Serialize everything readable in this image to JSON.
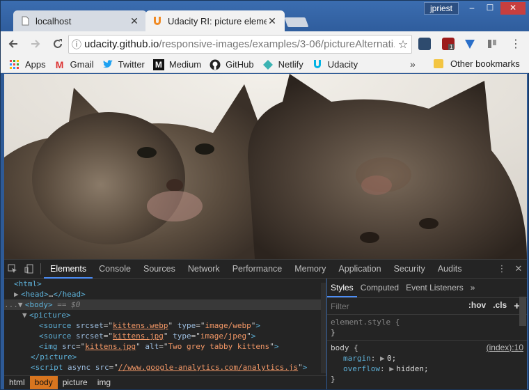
{
  "tabs": [
    {
      "title": "localhost",
      "active": false
    },
    {
      "title": "Udacity RI: picture eleme",
      "active": true
    }
  ],
  "user": "jpriest",
  "window_controls": {
    "minimize": "–",
    "maximize": "☐",
    "close": "✕"
  },
  "toolbar": {
    "url_host": "udacity.github.io",
    "url_path": "/responsive-images/examples/3-06/pictureAlternati..."
  },
  "extensions": [
    {
      "name": "udacity-ext",
      "color": "#2e4b6e"
    },
    {
      "name": "ublock-origin",
      "color": "#9c1b1b",
      "badge": "1"
    },
    {
      "name": "vpn-shield",
      "color": "#2a6fc9"
    },
    {
      "name": "readlater",
      "color": "#777777"
    }
  ],
  "bookmarks": {
    "items": [
      "Apps",
      "Gmail",
      "Twitter",
      "Medium",
      "GitHub",
      "Netlify",
      "Udacity"
    ],
    "more": "»",
    "other": "Other bookmarks"
  },
  "devtools": {
    "tabs": [
      "Elements",
      "Console",
      "Sources",
      "Network",
      "Performance",
      "Memory",
      "Application",
      "Security",
      "Audits"
    ],
    "active_tab": "Elements",
    "dom": {
      "html": "<html>",
      "head_open": "<head>",
      "head_ellipsis": "…",
      "head_close": "</head>",
      "body_prefix": "...",
      "body": "<body>",
      "body_eq": " == ",
      "body_var": "$0",
      "picture_open": "<picture>",
      "source1_srcset": "kittens.webp",
      "source1_type": "image/webp",
      "source2_srcset": "kittens.jpg",
      "source2_type": "image/jpeg",
      "img_src": "kittens.jpg",
      "img_alt": "Two grey tabby kittens",
      "picture_close": "</picture>",
      "script_src": "//www.google-analytics.com/analytics.js"
    },
    "breadcrumbs": [
      "html",
      "body",
      "picture",
      "img"
    ],
    "active_crumb": "body",
    "styles": {
      "tabs": [
        "Styles",
        "Computed",
        "Event Listeners"
      ],
      "more": "»",
      "filter_placeholder": "Filter",
      "hov": ":hov",
      "cls": ".cls",
      "add": "+",
      "element_style": "element.style {",
      "close_brace": "}",
      "body_selector": "body {",
      "body_source": "(index):10",
      "props": [
        {
          "name": "margin",
          "value": "0;"
        },
        {
          "name": "overflow",
          "value": "hidden;"
        }
      ]
    }
  }
}
